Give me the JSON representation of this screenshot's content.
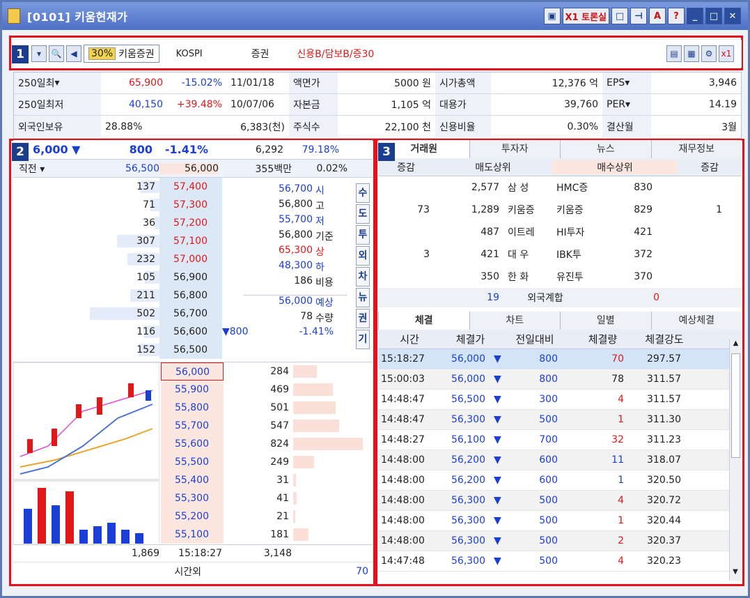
{
  "window": {
    "title": "[0101] 키움현재가"
  },
  "titlebar_buttons": [
    "X1 토론실",
    "A",
    "?"
  ],
  "toolbar": {
    "badge": "1",
    "margin": "30%",
    "stock_name": "키움증권",
    "market": "KOSPI",
    "sector": "증권",
    "credit": "신용B/담보B/증30"
  },
  "info_rows": [
    {
      "l1": "250일최",
      "v1": "65,900",
      "p1": "-15.02%",
      "d1": "11/01/18",
      "l2": "액면가",
      "v2": "5000 원",
      "l3": "시가총액",
      "v3": "12,376 억",
      "l4": "EPS",
      "v4": "3,946"
    },
    {
      "l1": "250일최저",
      "v1": "40,150",
      "p1": "+39.48%",
      "d1": "10/07/06",
      "l2": "자본금",
      "v2": "1,105 억",
      "l3": "대용가",
      "v3": "39,760",
      "l4": "PER",
      "v4": "14.19"
    },
    {
      "l1": "외국인보유",
      "v1": "28.88%",
      "p1": "",
      "d1": "6,383(천)",
      "l2": "주식수",
      "v2": "22,100 천",
      "l3": "신용비율",
      "v3": "0.30%",
      "l4": "결산월",
      "v4": "3월"
    }
  ],
  "quote": {
    "badge": "2",
    "price": "6,000",
    "change": "800",
    "rate": "-1.41%",
    "volume": "6,292",
    "ratio": "79.18%",
    "prev_label": "직전",
    "prev1": "56,500",
    "prev2": "56,000",
    "amount": "355백만",
    "amount_pct": "0.02%"
  },
  "asks": [
    {
      "qty": "137",
      "price": "57,400"
    },
    {
      "qty": "71",
      "price": "57,300"
    },
    {
      "qty": "36",
      "price": "57,200"
    },
    {
      "qty": "307",
      "price": "57,100"
    },
    {
      "qty": "232",
      "price": "57,000"
    },
    {
      "qty": "105",
      "price": "56,900"
    },
    {
      "qty": "211",
      "price": "56,800"
    },
    {
      "qty": "502",
      "price": "56,700"
    },
    {
      "qty": "116",
      "price": "56,600"
    },
    {
      "qty": "152",
      "price": "56,500"
    }
  ],
  "bids": [
    {
      "price": "56,000",
      "qty": "284"
    },
    {
      "price": "55,900",
      "qty": "469"
    },
    {
      "price": "55,800",
      "qty": "501"
    },
    {
      "price": "55,700",
      "qty": "547"
    },
    {
      "price": "55,600",
      "qty": "824"
    },
    {
      "price": "55,500",
      "qty": "249"
    },
    {
      "price": "55,400",
      "qty": "31"
    },
    {
      "price": "55,300",
      "qty": "41"
    },
    {
      "price": "55,200",
      "qty": "21"
    },
    {
      "price": "55,100",
      "qty": "181"
    }
  ],
  "stats": [
    {
      "v": "56,700",
      "l": "시"
    },
    {
      "v": "56,800",
      "l": "고"
    },
    {
      "v": "55,700",
      "l": "저"
    },
    {
      "v": "56,800",
      "l": "기준"
    },
    {
      "v": "65,300",
      "l": "상"
    },
    {
      "v": "48,300",
      "l": "하"
    },
    {
      "v": "186",
      "l": "비용"
    }
  ],
  "expect": {
    "price": "56,000",
    "label": "예상",
    "qty": "78",
    "qlabel": "수량",
    "chg": "▼800",
    "rate": "-1.41%"
  },
  "side_tabs": [
    "수",
    "도",
    "투",
    "외",
    "차",
    "뉴",
    "권",
    "기"
  ],
  "footer": {
    "ask_total": "1,869",
    "time": "15:18:27",
    "bid_total": "3,148",
    "after": "시간외",
    "after_val": "70"
  },
  "broker": {
    "badge": "3",
    "tabs": [
      "거래원",
      "투자자",
      "뉴스",
      "재무정보"
    ],
    "headers": [
      "증감",
      "매도상위",
      "매수상위",
      "증감"
    ],
    "rows": [
      {
        "d1": "",
        "sv": "2,577",
        "sn": "삼  성",
        "bn": "HMC증",
        "bv": "830",
        "d2": ""
      },
      {
        "d1": "73",
        "sv": "1,289",
        "sn": "키움증",
        "bn": "키움증",
        "bv": "829",
        "d2": "1"
      },
      {
        "d1": "",
        "sv": "487",
        "sn": "이트레",
        "bn": "HI투자",
        "bv": "421",
        "d2": ""
      },
      {
        "d1": "3",
        "sv": "421",
        "sn": "대  우",
        "bn": "IBK투",
        "bv": "372",
        "d2": ""
      },
      {
        "d1": "",
        "sv": "350",
        "sn": "한  화",
        "bn": "유진투",
        "bv": "370",
        "d2": ""
      }
    ],
    "foreign": {
      "sv": "19",
      "label": "외국계합",
      "bv": "0"
    }
  },
  "trades": {
    "tabs": [
      "체결",
      "차트",
      "일별",
      "예상체결"
    ],
    "headers": [
      "시간",
      "체결가",
      "전일대비",
      "체결량",
      "체결강도"
    ],
    "rows": [
      {
        "t": "15:18:27",
        "p": "56,000",
        "c": "800",
        "q": "70",
        "s": "297.57",
        "qc": "red"
      },
      {
        "t": "15:00:03",
        "p": "56,000",
        "c": "800",
        "q": "78",
        "s": "311.57",
        "qc": ""
      },
      {
        "t": "14:48:47",
        "p": "56,500",
        "c": "300",
        "q": "4",
        "s": "311.57",
        "qc": "red"
      },
      {
        "t": "14:48:47",
        "p": "56,300",
        "c": "500",
        "q": "1",
        "s": "311.30",
        "qc": "red"
      },
      {
        "t": "14:48:27",
        "p": "56,100",
        "c": "700",
        "q": "32",
        "s": "311.23",
        "qc": "red"
      },
      {
        "t": "14:48:00",
        "p": "56,200",
        "c": "600",
        "q": "11",
        "s": "318.07",
        "qc": "blue"
      },
      {
        "t": "14:48:00",
        "p": "56,200",
        "c": "600",
        "q": "1",
        "s": "320.50",
        "qc": "blue"
      },
      {
        "t": "14:48:00",
        "p": "56,300",
        "c": "500",
        "q": "4",
        "s": "320.72",
        "qc": "red"
      },
      {
        "t": "14:48:00",
        "p": "56,300",
        "c": "500",
        "q": "1",
        "s": "320.44",
        "qc": "red"
      },
      {
        "t": "14:48:00",
        "p": "56,300",
        "c": "500",
        "q": "2",
        "s": "320.37",
        "qc": "red"
      },
      {
        "t": "14:47:48",
        "p": "56,300",
        "c": "500",
        "q": "4",
        "s": "320.23",
        "qc": "red"
      }
    ]
  }
}
